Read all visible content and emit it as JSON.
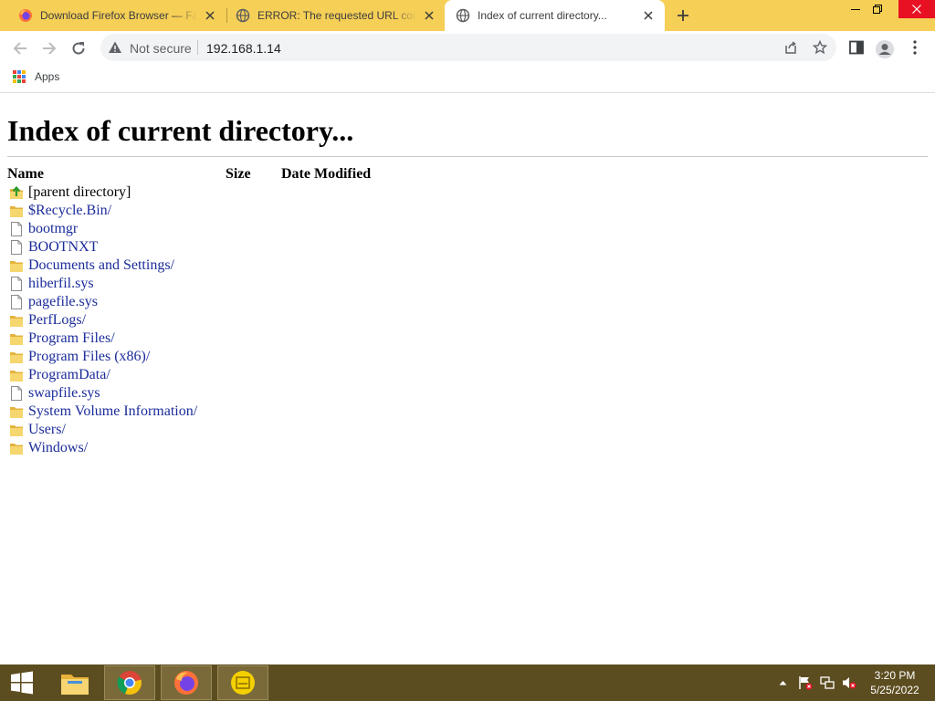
{
  "browser": {
    "tabs": [
      {
        "title": "Download Firefox Browser — Fast, Private & Free",
        "favicon": "firefox-icon",
        "active": false
      },
      {
        "title": "ERROR: The requested URL could not be retrieved",
        "favicon": "globe-icon",
        "active": false
      },
      {
        "title": "Index of current directory...",
        "favicon": "globe-icon",
        "active": true
      }
    ],
    "security_label": "Not secure",
    "url": "192.168.1.14",
    "bookmarks": {
      "apps_label": "Apps"
    }
  },
  "page": {
    "heading": "Index of current directory...",
    "columns": {
      "name": "Name",
      "size": "Size",
      "modified": "Date Modified"
    },
    "entries": [
      {
        "name": "[parent directory]",
        "type": "parent",
        "suffix": ""
      },
      {
        "name": "$Recycle.Bin",
        "type": "folder",
        "suffix": "/"
      },
      {
        "name": "bootmgr",
        "type": "file",
        "suffix": ""
      },
      {
        "name": "BOOTNXT",
        "type": "file",
        "suffix": ""
      },
      {
        "name": "Documents and Settings",
        "type": "folder",
        "suffix": "/"
      },
      {
        "name": "hiberfil.sys",
        "type": "file",
        "suffix": ""
      },
      {
        "name": "pagefile.sys",
        "type": "file",
        "suffix": ""
      },
      {
        "name": "PerfLogs",
        "type": "folder",
        "suffix": "/"
      },
      {
        "name": "Program Files",
        "type": "folder",
        "suffix": "/"
      },
      {
        "name": "Program Files (x86)",
        "type": "folder",
        "suffix": "/"
      },
      {
        "name": "ProgramData",
        "type": "folder",
        "suffix": "/"
      },
      {
        "name": "swapfile.sys",
        "type": "file",
        "suffix": ""
      },
      {
        "name": "System Volume Information",
        "type": "folder",
        "suffix": "/"
      },
      {
        "name": "Users",
        "type": "folder",
        "suffix": "/"
      },
      {
        "name": "Windows",
        "type": "folder",
        "suffix": "/"
      }
    ]
  },
  "taskbar": {
    "apps": [
      "windows-start-icon",
      "file-explorer-icon",
      "chrome-icon",
      "firefox-icon",
      "oki-app-icon"
    ],
    "time": "3:20 PM",
    "date": "5/25/2022"
  },
  "colors": {
    "tabstrip": "#f6cf57",
    "link": "#1b2c9a",
    "taskbar": "#5c4d20"
  }
}
